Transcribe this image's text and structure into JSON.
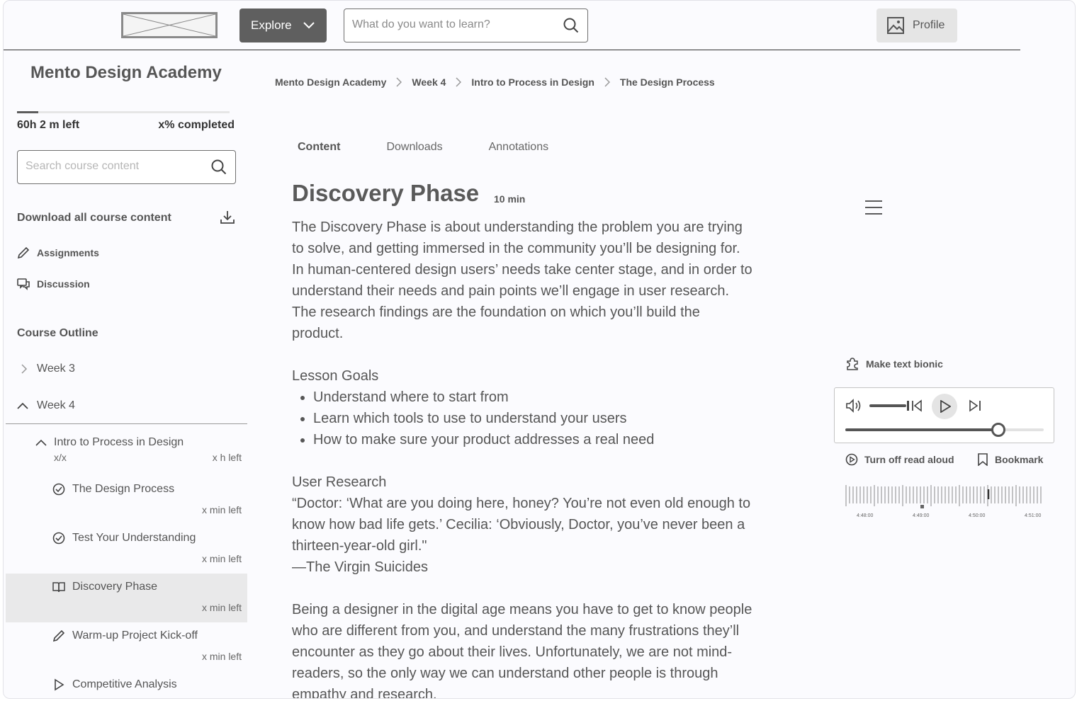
{
  "header": {
    "explore_label": "Explore",
    "search_placeholder": "What do you want to learn?",
    "profile_label": "Profile"
  },
  "sidebar": {
    "course_title": "Mento Design Academy",
    "progress_fraction": 0.1,
    "time_left": "60h 2 m left",
    "completed": "x% completed",
    "search_placeholder": "Search course content",
    "download_all": "Download all course content",
    "links": [
      {
        "label": "Assignments",
        "icon": "pencil-icon"
      },
      {
        "label": "Discussion",
        "icon": "chat-icon"
      }
    ],
    "outline_title": "Course Outline",
    "weeks": [
      {
        "label": "Week 3",
        "expanded": false
      },
      {
        "label": "Week 4",
        "expanded": true
      }
    ],
    "group": {
      "title": "Intro to Process in Design",
      "count": "x/x",
      "time": "x h left"
    },
    "lessons": [
      {
        "title": "The Design Process",
        "time": "x min left",
        "icon": "check-circle-icon",
        "active": false
      },
      {
        "title": "Test Your Understanding",
        "time": "x min left",
        "icon": "check-circle-icon",
        "active": false
      },
      {
        "title": "Discovery Phase",
        "time": "x min left",
        "icon": "book-icon",
        "active": true
      },
      {
        "title": "Warm-up Project Kick-off",
        "time": "x min left",
        "icon": "pencil-icon",
        "active": false
      },
      {
        "title": "Competitive Analysis",
        "time": "",
        "icon": "play-icon",
        "active": false
      }
    ]
  },
  "breadcrumb": [
    "Mento Design Academy",
    "Week 4",
    "Intro to Process in Design",
    "The Design Process"
  ],
  "tabs": [
    {
      "label": "Content",
      "active": true
    },
    {
      "label": "Downloads",
      "active": false
    },
    {
      "label": "Annotations",
      "active": false
    }
  ],
  "lesson": {
    "title": "Discovery Phase",
    "duration": "10 min",
    "intro": "The Discovery Phase is about understanding the problem you are trying to solve, and getting immersed in the community you’ll be designing for. In human-centered design users’ needs take center stage, and in order to understand their needs and pain points we’ll engage in user research. The research findings are the foundation on which you’ll build the product.",
    "goals_heading": "Lesson Goals",
    "goals": [
      "Understand where to start from",
      "Learn which tools to use to understand your users",
      "How to make sure your product addresses a real need"
    ],
    "research_heading": "User Research",
    "quote": "“Doctor: ‘What are you doing here, honey? You’re not even old enough to know how bad life gets.’ Cecilia: ‘Obviously, Doctor, you’ve never been a thirteen-year-old girl.\"",
    "quote_source": "—The Virgin Suicides",
    "body": "Being a designer in the digital age means you have to get to know people who are different from you, and understand the many frustrations they’ll encounter as they go about their lives. Unfortunately, we are not mind-readers, so the only way we can understand other people is through empathy and research."
  },
  "reader": {
    "bionic_label": "Make text bionic",
    "volume_fraction": 0.55,
    "seek_fraction": 0.77,
    "read_aloud_label": "Turn off read aloud",
    "bookmark_label": "Bookmark",
    "timeline_labels": [
      "4:48:00",
      "4:49:00",
      "4:50:00",
      "4:51:00"
    ]
  }
}
